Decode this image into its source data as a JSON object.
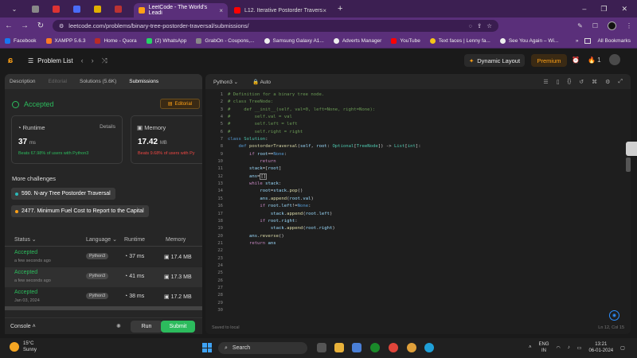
{
  "browser": {
    "tabs": [
      {
        "title": "LeetCode - The World's Leadi",
        "active": true
      },
      {
        "title": "L12. Iterative Postorder Travers",
        "active": false
      }
    ],
    "url": "leetcode.com/problems/binary-tree-postorder-traversal/submissions/",
    "window_controls": [
      "–",
      "❐",
      "✕"
    ]
  },
  "bookmarks": [
    {
      "label": "Facebook",
      "color": "#1877f2"
    },
    {
      "label": "XAMPP 5.6.3",
      "color": "#fb7a24"
    },
    {
      "label": "Home - Quora",
      "color": "#b92b27"
    },
    {
      "label": "(2) WhatsApp",
      "color": "#25d366"
    },
    {
      "label": "GrabOn - Coupons,...",
      "color": "#888888"
    },
    {
      "label": "Samsung Galaxy A1...",
      "color": "#ffffff"
    },
    {
      "label": "Adverts Manager",
      "color": "#ffffff"
    },
    {
      "label": "YouTube",
      "color": "#ff0000"
    },
    {
      "label": "Text faces | Lenny fa...",
      "color": "#f5c518"
    },
    {
      "label": "See You Again – Wi...",
      "color": "#ffffff"
    }
  ],
  "bookmarks_more": "»",
  "bookmarks_all": "All Bookmarks",
  "leetcode": {
    "problem_list": "Problem List",
    "dynamic_layout": "Dynamic Layout",
    "premium": "Premium",
    "streak": "1"
  },
  "left_panel": {
    "tabs": [
      {
        "label": "Description",
        "state": "normal"
      },
      {
        "label": "Editorial",
        "state": "dim"
      },
      {
        "label": "Solutions (5.6K)",
        "state": "normal"
      },
      {
        "label": "Submissions",
        "state": "active"
      }
    ],
    "status": "Accepted",
    "editorial_btn": "Editorial",
    "runtime": {
      "label": "Runtime",
      "value": "37",
      "unit": "ms",
      "beats_pct": "67.98%",
      "beats_text": "Beats 67.98% of users with Python3",
      "details": "Details"
    },
    "memory": {
      "label": "Memory",
      "value": "17.42",
      "unit": "MB",
      "beats_pct": "9.68%",
      "beats_text": "Beats 9.68% of users with Py"
    },
    "more_challenges": "More challenges",
    "challenges": [
      {
        "label": "590. N-ary Tree Postorder Traversal",
        "color": "#2cb8b8"
      },
      {
        "label": "2477. Minimum Fuel Cost to Report to the Capital",
        "color": "#ffa116"
      }
    ],
    "table_headers": {
      "status": "Status",
      "language": "Language",
      "runtime": "Runtime",
      "memory": "Memory"
    },
    "submissions": [
      {
        "status": "Accepted",
        "time": "a few seconds ago",
        "lang": "Python3",
        "runtime": "37 ms",
        "memory": "17.4 MB"
      },
      {
        "status": "Accepted",
        "time": "a few seconds ago",
        "lang": "Python3",
        "runtime": "41 ms",
        "memory": "17.3 MB"
      },
      {
        "status": "Accepted",
        "time": "Jan 03, 2024",
        "lang": "Python3",
        "runtime": "38 ms",
        "memory": "17.2 MB"
      }
    ],
    "console": "Console",
    "run": "Run",
    "submit": "Submit"
  },
  "editor": {
    "language": "Python3",
    "auto": "Auto",
    "saved": "Saved to local",
    "cursor": "Ln 12, Col 15",
    "line_numbers": [
      "1",
      "2",
      "3",
      "4",
      "5",
      "6",
      "7",
      "8",
      "9",
      "10",
      "11",
      "12",
      "13",
      "14",
      "15",
      "16",
      "17",
      "18",
      "19",
      "20",
      "21",
      "22",
      "23",
      "24",
      "25",
      "26",
      "27",
      "28",
      "29",
      "30"
    ]
  },
  "taskbar": {
    "temp": "15°C",
    "weather": "Sunny",
    "search": "Search",
    "lang": "ENG",
    "region": "IN",
    "time": "13:21",
    "date": "06-01-2024"
  }
}
